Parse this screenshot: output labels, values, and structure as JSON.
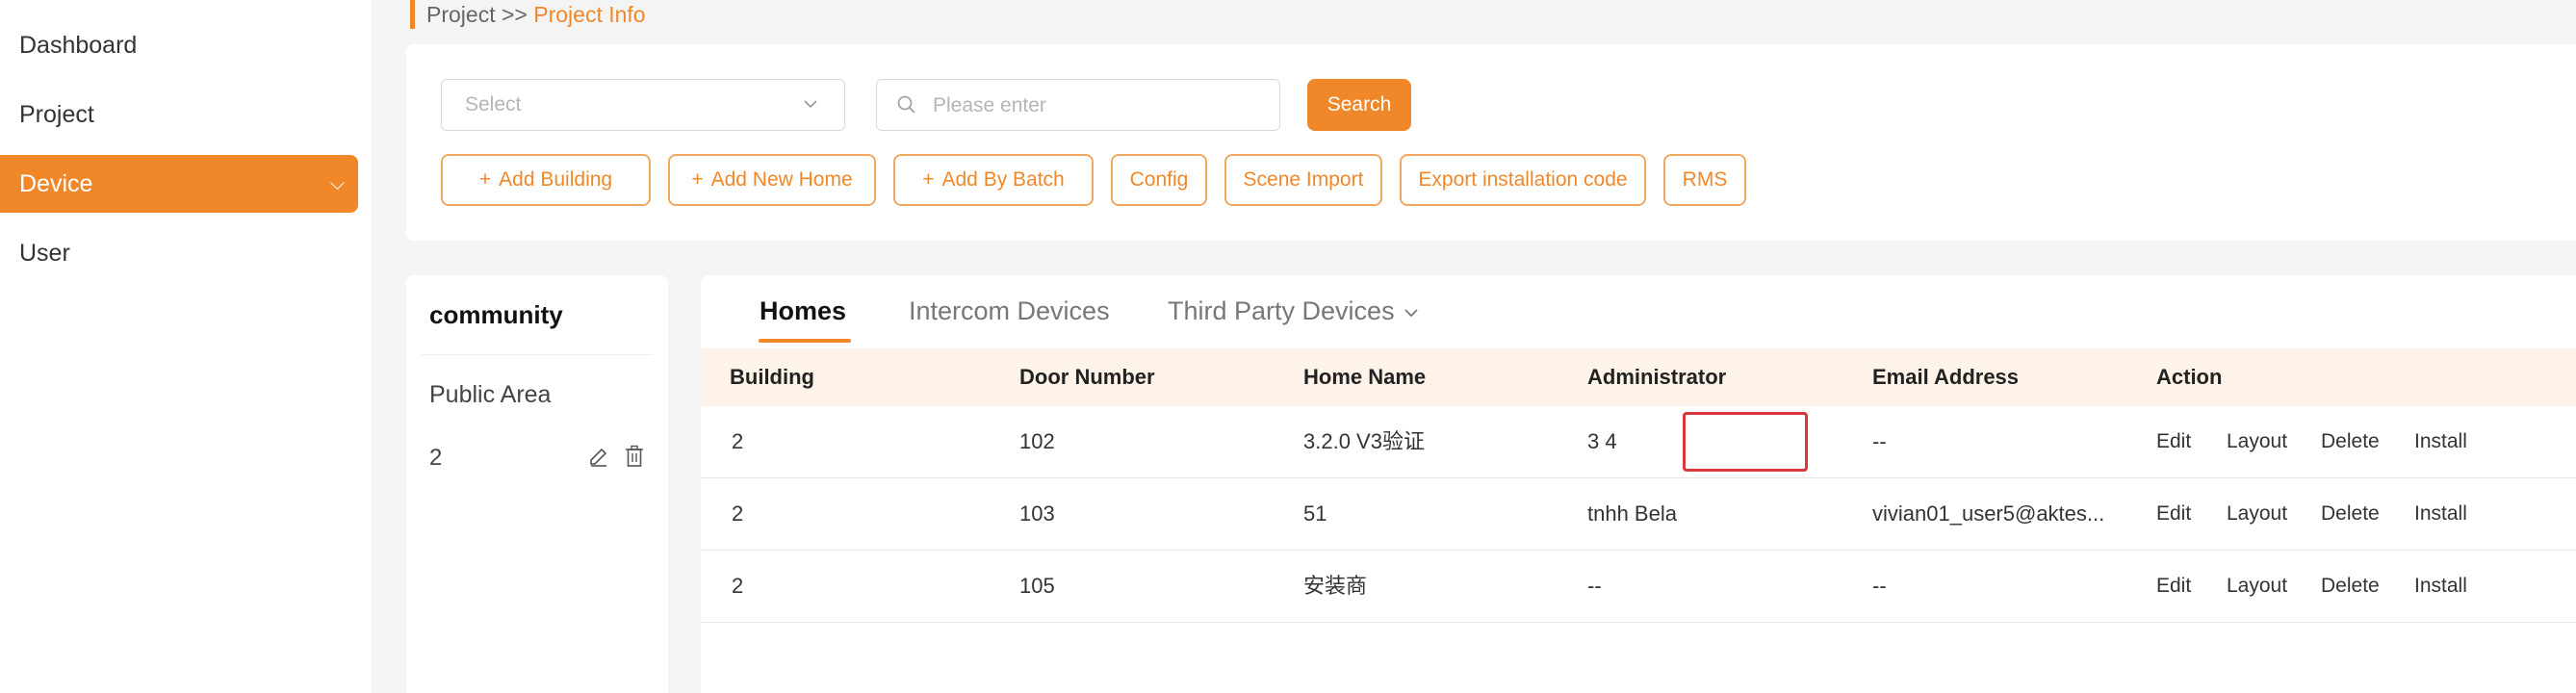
{
  "sidebar": {
    "items": [
      {
        "label": "Dashboard"
      },
      {
        "label": "Project"
      },
      {
        "label": "Device",
        "chevron": "⌵"
      },
      {
        "label": "User"
      }
    ]
  },
  "breadcrumb": {
    "parent": "Project",
    "separator": ">>",
    "current": "Project Info"
  },
  "filters": {
    "select_placeholder": "Select",
    "search_placeholder": "Please enter",
    "search_button": "Search"
  },
  "actions": [
    {
      "label": "Add Building",
      "plus": "+"
    },
    {
      "label": "Add New Home",
      "plus": "+"
    },
    {
      "label": "Add By Batch",
      "plus": "+"
    },
    {
      "label": "Config"
    },
    {
      "label": "Scene Import"
    },
    {
      "label": "Export installation code"
    },
    {
      "label": "RMS"
    }
  ],
  "community": {
    "title": "community",
    "public_area": "Public Area",
    "items": [
      {
        "label": "2"
      }
    ]
  },
  "tabs": [
    {
      "label": "Homes",
      "active": true
    },
    {
      "label": "Intercom Devices"
    },
    {
      "label": "Third Party Devices",
      "chevron": "⌵"
    }
  ],
  "table": {
    "columns": [
      "Building",
      "Door Number",
      "Home Name",
      "Administrator",
      "Email Address",
      "Action"
    ],
    "rows": [
      {
        "building": "2",
        "door": "102",
        "home": "3.2.0 V3验证",
        "admin": "3 4",
        "email": "--"
      },
      {
        "building": "2",
        "door": "103",
        "home": "51",
        "admin": "tnhh Bela",
        "email": "vivian01_user5@aktes..."
      },
      {
        "building": "2",
        "door": "105",
        "home": "安装商",
        "admin": "--",
        "email": "--"
      }
    ],
    "row_actions": [
      "Edit",
      "Layout",
      "Delete",
      "Install"
    ]
  },
  "colors": {
    "accent": "#f0882a",
    "highlight": "#d9363e"
  },
  "icons": {
    "search": "search-icon",
    "edit": "edit-icon",
    "delete": "trash-icon"
  }
}
